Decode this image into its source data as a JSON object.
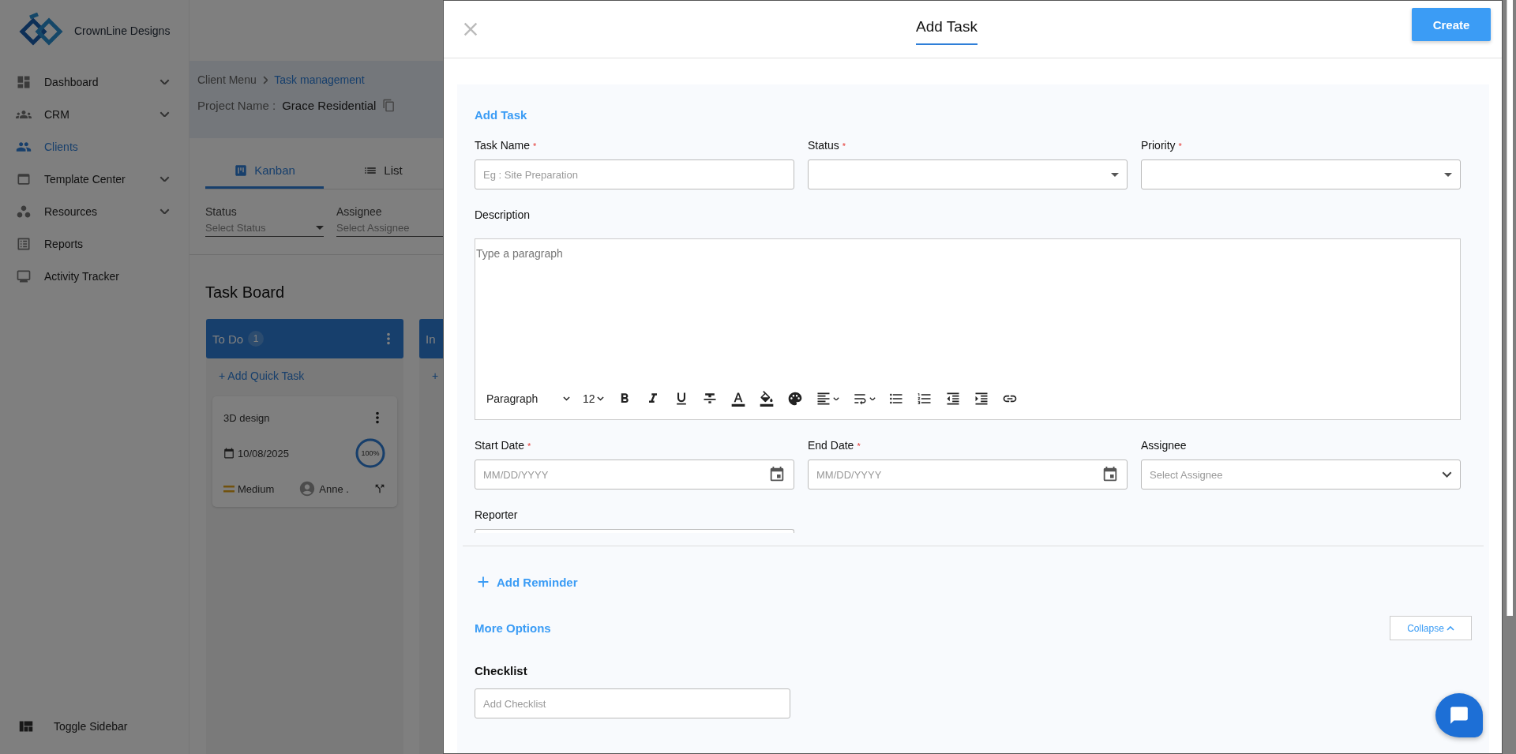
{
  "sidebar": {
    "brand": "CrownLine Designs",
    "items": [
      {
        "label": "Dashboard",
        "selected": false,
        "expandable": true
      },
      {
        "label": "CRM",
        "selected": false,
        "expandable": true
      },
      {
        "label": "Clients",
        "selected": true,
        "expandable": false
      },
      {
        "label": "Template Center",
        "selected": false,
        "expandable": true
      },
      {
        "label": "Resources",
        "selected": false,
        "expandable": true
      },
      {
        "label": "Reports",
        "selected": false,
        "expandable": false
      },
      {
        "label": "Activity Tracker",
        "selected": false,
        "expandable": false
      }
    ],
    "toggle": "Toggle Sidebar"
  },
  "breadcrumb": [
    "Client Menu",
    "Task management"
  ],
  "project": {
    "label": "Project Name :",
    "value": "Grace Residential"
  },
  "view_tabs": [
    {
      "label": "Kanban",
      "selected": true
    },
    {
      "label": "List",
      "selected": false
    }
  ],
  "filters": [
    {
      "label": "Status",
      "placeholder": "Select Status"
    },
    {
      "label": "Assignee",
      "placeholder": "Select Assignee"
    }
  ],
  "board": {
    "title": "Task Board",
    "columns": [
      {
        "title": "To Do",
        "count": "1",
        "add": "+ Add Quick Task",
        "cards": [
          {
            "title": "3D design",
            "date": "10/08/2025",
            "progress": "100%",
            "level": 1,
            "priority": "Medium",
            "assignee": "Anne ."
          }
        ]
      },
      {
        "title": "In",
        "add": "+"
      }
    ]
  },
  "drawer": {
    "title": "Add Task",
    "create": "Create",
    "section": "Add Task",
    "required_mark": "*",
    "fields": [
      {
        "kind": "text",
        "label": "Task Name",
        "required": true,
        "placeholder": "Eg : Site Preparation"
      },
      {
        "kind": "select",
        "label": "Status",
        "required": true
      },
      {
        "kind": "select",
        "label": "Priority",
        "required": true
      },
      {
        "kind": "editor",
        "label": "Description",
        "required": false,
        "placeholder": "Type a paragraph",
        "block": "Paragraph",
        "size": "12"
      },
      {
        "kind": "date",
        "label": "Start Date",
        "required": true,
        "placeholder": "MM/DD/YYYY"
      },
      {
        "kind": "date",
        "label": "End Date",
        "required": true,
        "placeholder": "MM/DD/YYYY"
      },
      {
        "kind": "combo",
        "label": "Assignee",
        "required": false,
        "placeholder": "Select Assignee"
      },
      {
        "kind": "text",
        "label": "Reporter",
        "required": false
      }
    ],
    "reminder": "Add Reminder",
    "more_options": "More Options",
    "collapse": "Collapse",
    "checklist": {
      "label": "Checklist",
      "placeholder": "Add Checklist"
    }
  }
}
